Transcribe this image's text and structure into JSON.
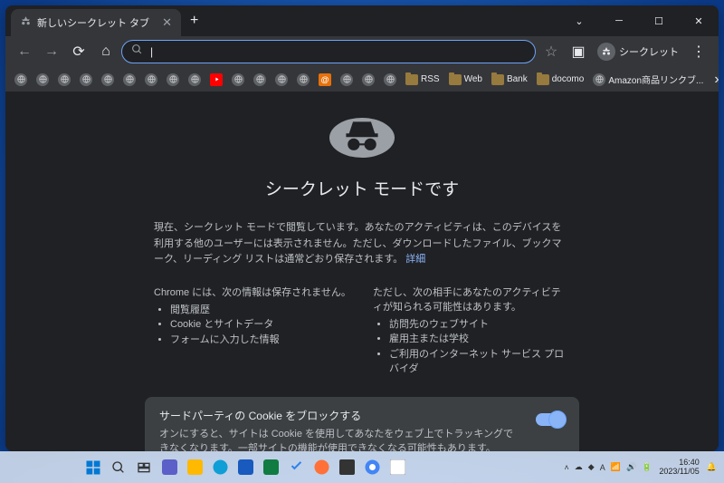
{
  "tab": {
    "title": "新しいシークレット タブ"
  },
  "toolbar": {
    "incognito_label": "シークレット"
  },
  "bookmarks": {
    "rss": "RSS",
    "web": "Web",
    "bank": "Bank",
    "docomo": "docomo",
    "amazon": "Amazon商品リンクブ..."
  },
  "content": {
    "heading": "シークレット モードです",
    "desc_prefix": "現在、シークレット モードで閲覧しています。あなたのアクティビティは、このデバイスを利用する他のユーザーには表示されません。ただし、ダウンロードしたファイル、ブックマーク、リーディング リストは通常どおり保存されます。",
    "desc_link": "詳細",
    "col1_heading": "Chrome には、次の情報は保存されません。",
    "col1_item1": "閲覧履歴",
    "col1_item2": "Cookie とサイトデータ",
    "col1_item3": "フォームに入力した情報",
    "col2_heading": "ただし、次の相手にあなたのアクティビティが知られる可能性はあります。",
    "col2_item1": "訪問先のウェブサイト",
    "col2_item2": "雇用主または学校",
    "col2_item3": "ご利用のインターネット サービス プロバイダ",
    "toggle_title": "サードパーティの Cookie をブロックする",
    "toggle_desc": "オンにすると、サイトは Cookie を使用してあなたをウェブ上でトラッキングできなくなります。一部サイトの機能が使用できなくなる可能性もあります。"
  },
  "taskbar": {
    "time": "16:40",
    "date": "2023/11/05"
  }
}
